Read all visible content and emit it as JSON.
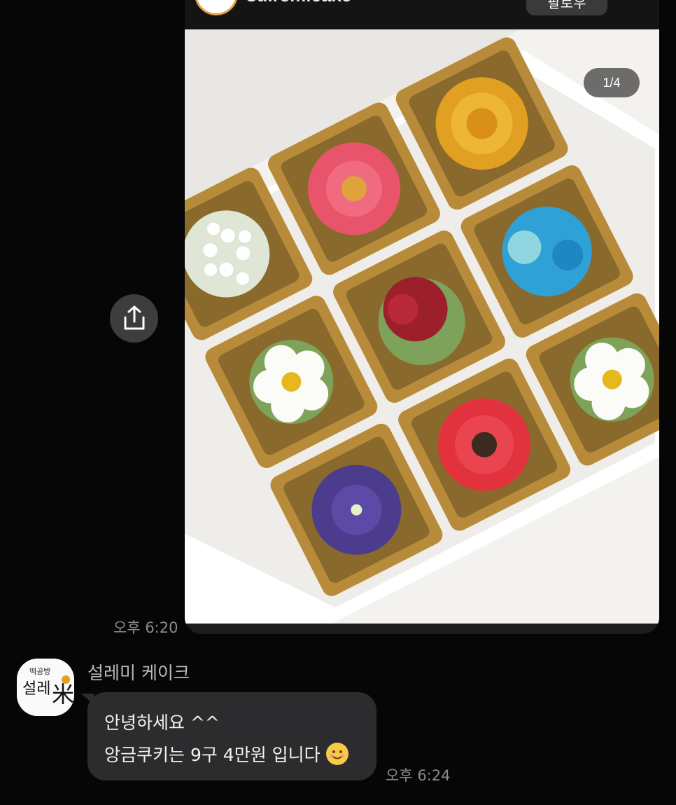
{
  "shared_post": {
    "account_name": "sulremicake",
    "follow_label": "팔로우",
    "page_indicator": "1/4",
    "photo_alt": "떡 케이크 9구 상자 - 꽃 장식 앙금쿠키"
  },
  "share_button": {
    "icon": "share-icon"
  },
  "shared_post_time": "오후 6:20",
  "sender": {
    "name": "설레미 케이크",
    "avatar_icon": "seollemi-logo"
  },
  "message": {
    "line1": "안녕하세요 ^^",
    "line2": "앙금쿠키는 9구 4만원 입니다",
    "emoji_icon": "smiling-face-icon",
    "time": "오후 6:24"
  },
  "colors": {
    "background": "#060606",
    "bubble": "#2c2c2e",
    "timestamp": "#8a8a8a"
  }
}
